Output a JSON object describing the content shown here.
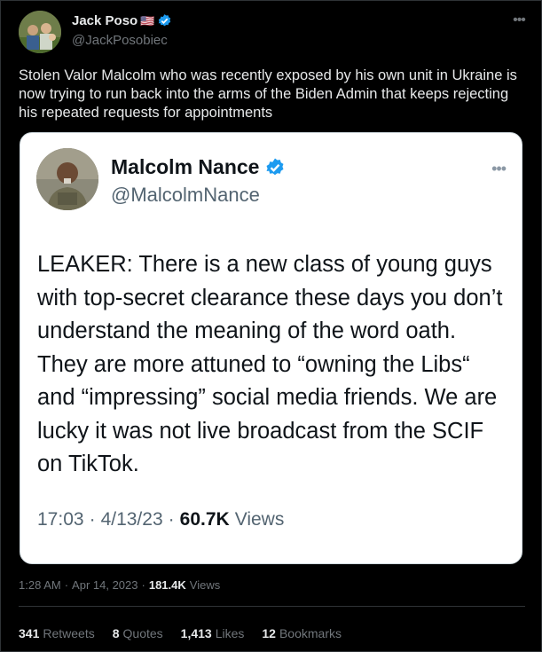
{
  "tweet": {
    "author": {
      "display_name": "Jack Poso",
      "flag": "🇺🇸",
      "handle": "@JackPosobiec"
    },
    "more_icon": "more-horizontal-icon",
    "text": "Stolen Valor Malcolm who was recently exposed by his own unit in Ukraine is now trying to run back into the arms of the Biden Admin that keeps rejecting his repeated requests for appointments",
    "quoted": {
      "display_name": "Malcolm Nance",
      "handle": "@MalcolmNance",
      "text": "LEAKER:  There is a new class of young guys with top-secret clearance these days you don’t understand the meaning of the word oath. They are more attuned to “owning the Libs“ and “impressing” social media friends. We are lucky it was not live broadcast from the SCIF on TikTok.",
      "time": "17:03",
      "date": "4/13/23",
      "views_count": "60.7K",
      "views_label": "Views"
    },
    "time": "1:28 AM",
    "date": "Apr 14, 2023",
    "views_count": "181.4K",
    "views_label": "Views",
    "separator": "·",
    "stats": {
      "retweets_count": "341",
      "retweets_label": "Retweets",
      "quotes_count": "8",
      "quotes_label": "Quotes",
      "likes_count": "1,413",
      "likes_label": "Likes",
      "bookmarks_count": "12",
      "bookmarks_label": "Bookmarks"
    },
    "colors": {
      "background": "#000000",
      "verified": "#1d9bf0",
      "secondary_text": "#71767b"
    }
  }
}
